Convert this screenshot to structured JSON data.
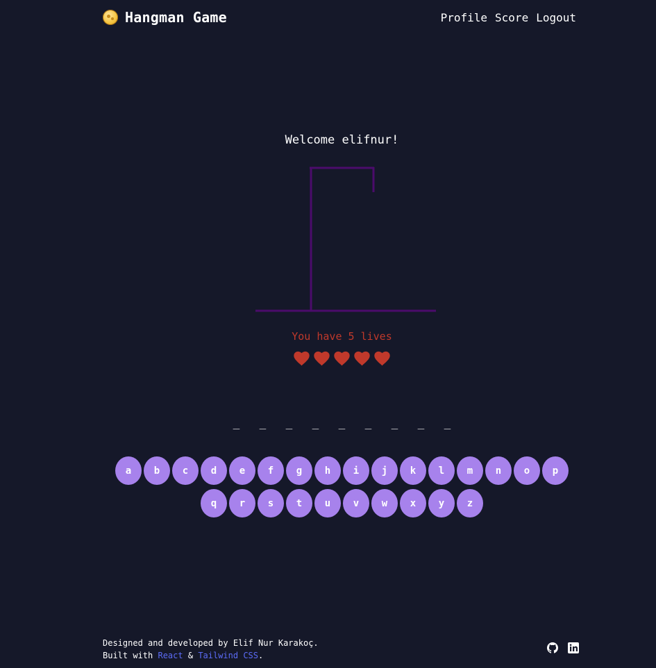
{
  "header": {
    "title": "Hangman Game",
    "nav": [
      "Profile",
      "Score",
      "Logout"
    ]
  },
  "game": {
    "welcome": "Welcome elifnur!",
    "lives_text": "You have 5 lives",
    "lives": 5,
    "word_blanks": [
      "_",
      "_",
      "_",
      "_",
      "_",
      "_",
      "_",
      "_",
      "_"
    ],
    "letters": [
      "a",
      "b",
      "c",
      "d",
      "e",
      "f",
      "g",
      "h",
      "i",
      "j",
      "k",
      "l",
      "m",
      "n",
      "o",
      "p",
      "q",
      "r",
      "s",
      "t",
      "u",
      "v",
      "w",
      "x",
      "y",
      "z"
    ]
  },
  "footer": {
    "line1": "Designed and developed by Elif Nur Karakoç.",
    "built_with": "Built with",
    "react": "React",
    "amp": "&",
    "tailwind": "Tailwind CSS",
    "period": "."
  },
  "colors": {
    "background": "#151829",
    "key": "#a782ec",
    "gallows": "#4b0b6b",
    "lives": "#c0392b",
    "link": "#5b6bf5"
  },
  "icons": [
    "coin-logo-icon",
    "heart-icon",
    "github-icon",
    "linkedin-icon"
  ]
}
